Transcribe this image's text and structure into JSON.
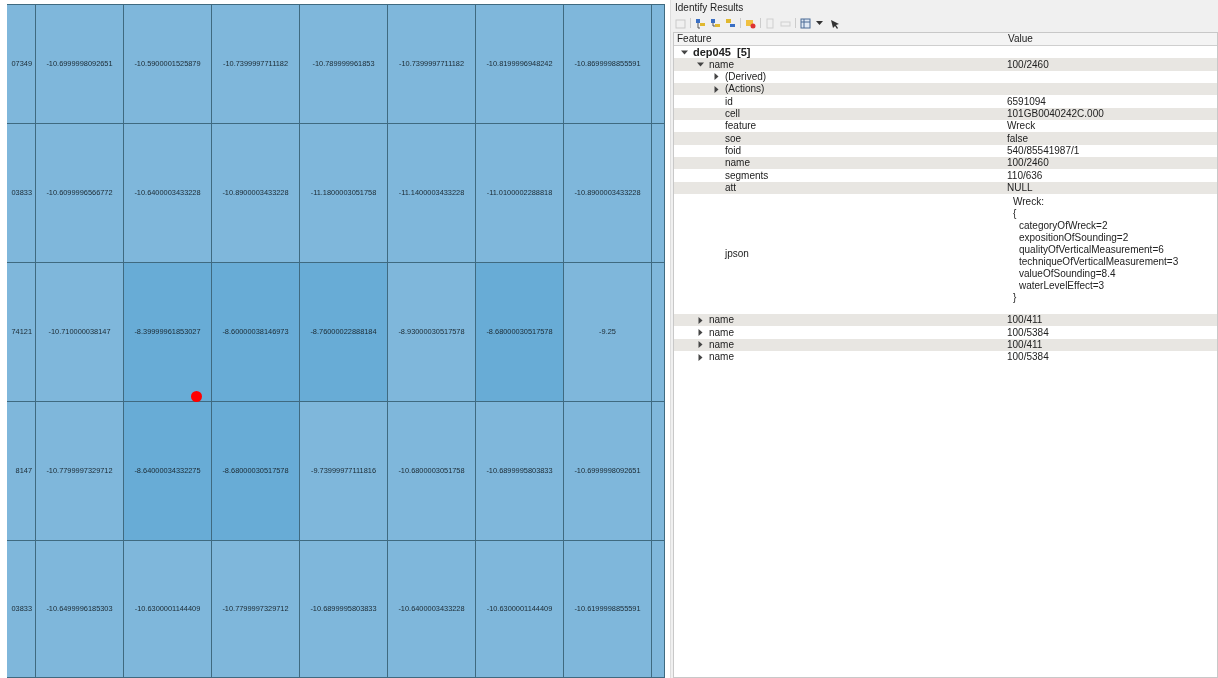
{
  "map": {
    "rows": [
      {
        "cells": [
          {
            "text": "07349",
            "color": "#7fb7db"
          },
          {
            "text": "-10.6999998092651",
            "color": "#7fb7db"
          },
          {
            "text": "-10.5900001525879",
            "color": "#7fb7db"
          },
          {
            "text": "-10.7399997711182",
            "color": "#7fb7db"
          },
          {
            "text": "-10.789999961853",
            "color": "#7fb7db"
          },
          {
            "text": "-10.7399997711182",
            "color": "#7fb7db"
          },
          {
            "text": "-10.8199996948242",
            "color": "#7fb7db"
          },
          {
            "text": "-10.8699998855591",
            "color": "#7fb7db"
          },
          {
            "color": "#7fb7db"
          }
        ]
      },
      {
        "cells": [
          {
            "text": "03833",
            "color": "#7fb7db"
          },
          {
            "text": "-10.6099996566772",
            "color": "#7fb7db"
          },
          {
            "text": "-10.6400003433228",
            "color": "#7fb7db"
          },
          {
            "text": "-10.8900003433228",
            "color": "#7fb7db"
          },
          {
            "text": "-11.1800003051758",
            "color": "#7fb7db"
          },
          {
            "text": "-11.1400003433228",
            "color": "#7fb7db"
          },
          {
            "text": "-11.0100002288818",
            "color": "#7fb7db"
          },
          {
            "text": "-10.8900003433228",
            "color": "#7fb7db"
          },
          {
            "color": "#7fb7db"
          }
        ]
      },
      {
        "cells": [
          {
            "text": "74121",
            "color": "#7fb7db"
          },
          {
            "text": "-10.710000038147",
            "color": "#7fb7db"
          },
          {
            "text": "-8.39999961853027",
            "color": "#68acd6"
          },
          {
            "text": "-8.60000038146973",
            "color": "#68acd6"
          },
          {
            "text": "-8.76000022888184",
            "color": "#68acd6"
          },
          {
            "text": "-8.93000030517578",
            "color": "#7fb7db"
          },
          {
            "text": "-8.68000030517578",
            "color": "#68acd6"
          },
          {
            "text": "-9.25",
            "color": "#7fb7db"
          },
          {
            "color": "#7fb7db"
          }
        ]
      },
      {
        "cells": [
          {
            "text": "8147",
            "color": "#7fb7db"
          },
          {
            "text": "-10.7799997329712",
            "color": "#7fb7db"
          },
          {
            "text": "-8.64000034332275",
            "color": "#68acd6"
          },
          {
            "text": "-8.68000030517578",
            "color": "#68acd6"
          },
          {
            "text": "-9.73999977111816",
            "color": "#7fb7db"
          },
          {
            "text": "-10.6800003051758",
            "color": "#7fb7db"
          },
          {
            "text": "-10.6899995803833",
            "color": "#7fb7db"
          },
          {
            "text": "-10.6999998092651",
            "color": "#7fb7db"
          },
          {
            "color": "#7fb7db"
          }
        ]
      },
      {
        "cells": [
          {
            "text": "03833",
            "color": "#7fb7db"
          },
          {
            "text": "-10.6499996185303",
            "color": "#7fb7db"
          },
          {
            "text": "-10.6300001144409",
            "color": "#7fb7db"
          },
          {
            "text": "-10.7799997329712",
            "color": "#7fb7db"
          },
          {
            "text": "-10.6899995803833",
            "color": "#7fb7db"
          },
          {
            "text": "-10.6400003433228",
            "color": "#7fb7db"
          },
          {
            "text": "-10.6300001144409",
            "color": "#7fb7db"
          },
          {
            "text": "-10.6199998855591",
            "color": "#7fb7db"
          },
          {
            "color": "#7fb7db"
          }
        ]
      }
    ]
  },
  "panel": {
    "title": "Identify Results",
    "columns": [
      "Feature",
      "Value"
    ],
    "tree": [
      {
        "kind": "layer",
        "label": "dep045  [5]",
        "expanded": true,
        "children": [
          {
            "kind": "branch",
            "label": "name",
            "value": "100/2460",
            "expanded": true,
            "children": [
              {
                "kind": "branch",
                "label": "(Derived)",
                "expanded": false
              },
              {
                "kind": "branch",
                "label": "(Actions)",
                "expanded": false
              },
              {
                "kind": "leaf",
                "label": "id",
                "value": "6591094"
              },
              {
                "kind": "leaf",
                "label": "cell",
                "value": "101GB0040242C.000"
              },
              {
                "kind": "leaf",
                "label": "feature",
                "value": "Wreck"
              },
              {
                "kind": "leaf",
                "label": "soe",
                "value": "false"
              },
              {
                "kind": "leaf",
                "label": "foid",
                "value": "540/85541987/1"
              },
              {
                "kind": "leaf",
                "label": "name",
                "value": "100/2460"
              },
              {
                "kind": "leaf",
                "label": "segments",
                "value": "110/636"
              },
              {
                "kind": "leaf",
                "label": "att",
                "value": "NULL"
              },
              {
                "kind": "block",
                "label": "jpson",
                "heading": "Wreck:",
                "open": "{",
                "entries": [
                  "categoryOfWreck=2",
                  "expositionOfSounding=2",
                  "qualityOfVerticalMeasurement=6",
                  "techniqueOfVerticalMeasurement=3",
                  "valueOfSounding=8.4",
                  "waterLevelEffect=3"
                ],
                "close": "}"
              }
            ]
          },
          {
            "kind": "branch",
            "label": "name",
            "value": "100/411",
            "expanded": false
          },
          {
            "kind": "branch",
            "label": "name",
            "value": "100/5384",
            "expanded": false
          },
          {
            "kind": "branch",
            "label": "name",
            "value": "100/411",
            "expanded": false
          },
          {
            "kind": "branch",
            "label": "name",
            "value": "100/5384",
            "expanded": false
          }
        ]
      }
    ]
  }
}
